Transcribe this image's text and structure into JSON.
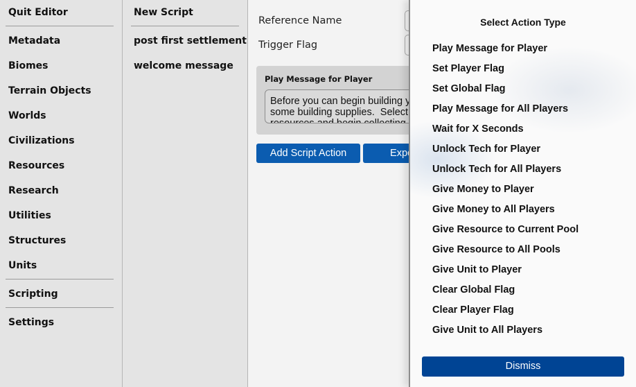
{
  "sidebar": {
    "quit": "Quit Editor",
    "items": [
      "Metadata",
      "Biomes",
      "Terrain Objects",
      "Worlds",
      "Civilizations",
      "Resources",
      "Research",
      "Utilities",
      "Structures",
      "Units"
    ],
    "scripting": "Scripting",
    "settings": "Settings"
  },
  "scripts": {
    "new_script": "New Script",
    "items": [
      "post first settlement",
      "welcome message"
    ]
  },
  "editor": {
    "reference_name_label": "Reference Name",
    "trigger_flag_label": "Trigger Flag",
    "action": {
      "title": "Play Message for Player",
      "message": "Before you can begin building your\nsome building supplies.  Select\nresources and begin collecting"
    },
    "add_action_label": "Add Script Action",
    "export_label": "Export"
  },
  "dialog": {
    "title": "Select Action Type",
    "options": [
      "Play Message for Player",
      "Set Player Flag",
      "Set Global Flag",
      "Play Message for All Players",
      "Wait for X Seconds",
      "Unlock Tech for Player",
      "Unlock Tech for All Players",
      "Give Money to Player",
      "Give Money to All Players",
      "Give Resource to Current Pool",
      "Give Resource to All Pools",
      "Give Unit to Player",
      "Clear Global Flag",
      "Clear Player Flag",
      "Give Unit to All Players"
    ],
    "dismiss_label": "Dismiss"
  },
  "colors": {
    "button_primary": "#0b5cb0",
    "dismiss_button": "#004494"
  }
}
